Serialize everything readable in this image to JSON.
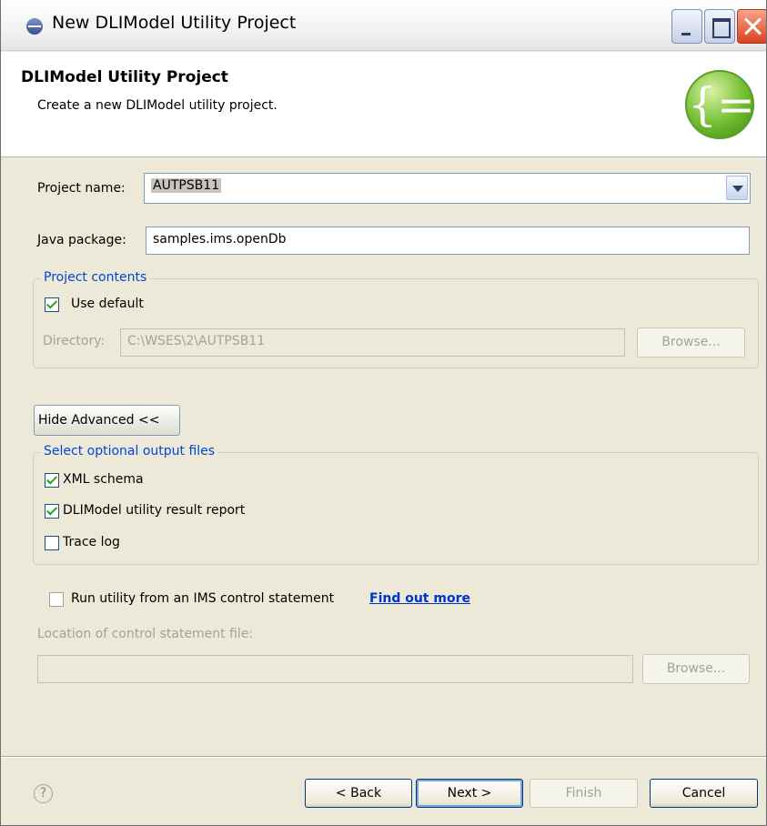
{
  "window": {
    "title": "New DLIModel Utility Project"
  },
  "header": {
    "title": "DLIModel Utility Project",
    "description": "Create a new DLIModel utility project."
  },
  "form": {
    "project_name_label": "Project name:",
    "project_name_value": "AUTPSB11",
    "java_package_label": "Java package:",
    "java_package_value": "samples.ims.openDb"
  },
  "project_contents": {
    "title": "Project contents",
    "use_default_label": "Use default",
    "use_default_checked": true,
    "directory_label": "Directory:",
    "directory_value": "C:\\WSES\\2\\AUTPSB11",
    "browse_label": "Browse..."
  },
  "advanced": {
    "toggle_label": "Hide Advanced <<"
  },
  "output_files": {
    "title": "Select optional output files",
    "options": [
      {
        "label": "XML schema",
        "checked": true
      },
      {
        "label": "DLIModel utility result report",
        "checked": true
      },
      {
        "label": "Trace log",
        "checked": false
      }
    ]
  },
  "control_statement": {
    "run_label": "Run utility from an IMS control statement",
    "run_checked": false,
    "find_out_more": "Find out more",
    "location_label": "Location of control statement file:",
    "location_value": "",
    "browse_label": "Browse..."
  },
  "buttons": {
    "help_glyph": "?",
    "back": "< Back",
    "next": "Next >",
    "finish": "Finish",
    "cancel": "Cancel"
  },
  "icons": {
    "title_icon": "wizard-title-icon",
    "header_logo": "dlimodel-logo-icon",
    "help": "help-icon"
  },
  "colors": {
    "group_title": "#0046d5",
    "link": "#0033cc",
    "check": "#21a121"
  }
}
